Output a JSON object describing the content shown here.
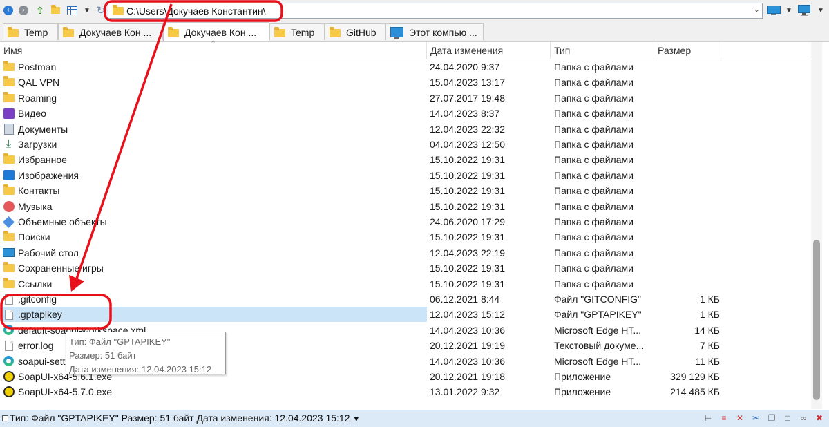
{
  "address": {
    "path": "C:\\Users\\Докучаев Константин\\"
  },
  "tabs": [
    {
      "label": "Temp",
      "icon": "folder-icon"
    },
    {
      "label": "Докучаев Кон ...",
      "icon": "folder-icon"
    },
    {
      "label": "Докучаев Кон ...",
      "icon": "folder-icon",
      "active": true
    },
    {
      "label": "Temp",
      "icon": "folder-icon"
    },
    {
      "label": "GitHub",
      "icon": "folder-icon"
    },
    {
      "label": "Этот компью ...",
      "icon": "computer-icon"
    }
  ],
  "columns": {
    "name": "Имя",
    "date": "Дата изменения",
    "type": "Тип",
    "size": "Размер"
  },
  "files": [
    {
      "name": "Postman",
      "date": "24.04.2020 9:37",
      "type": "Папка с файлами",
      "size": "",
      "icon": "folder-icon"
    },
    {
      "name": "QAL VPN",
      "date": "15.04.2023 13:17",
      "type": "Папка с файлами",
      "size": "",
      "icon": "folder-icon"
    },
    {
      "name": "Roaming",
      "date": "27.07.2017 19:48",
      "type": "Папка с файлами",
      "size": "",
      "icon": "folder-icon"
    },
    {
      "name": "Видео",
      "date": "14.04.2023 8:37",
      "type": "Папка с файлами",
      "size": "",
      "icon": "video-folder-icon"
    },
    {
      "name": "Документы",
      "date": "12.04.2023 22:32",
      "type": "Папка с файлами",
      "size": "",
      "icon": "documents-folder-icon"
    },
    {
      "name": "Загрузки",
      "date": "04.04.2023 12:50",
      "type": "Папка с файлами",
      "size": "",
      "icon": "downloads-folder-icon"
    },
    {
      "name": "Избранное",
      "date": "15.10.2022 19:31",
      "type": "Папка с файлами",
      "size": "",
      "icon": "folder-icon"
    },
    {
      "name": "Изображения",
      "date": "15.10.2022 19:31",
      "type": "Папка с файлами",
      "size": "",
      "icon": "pictures-folder-icon"
    },
    {
      "name": "Контакты",
      "date": "15.10.2022 19:31",
      "type": "Папка с файлами",
      "size": "",
      "icon": "folder-icon"
    },
    {
      "name": "Музыка",
      "date": "15.10.2022 19:31",
      "type": "Папка с файлами",
      "size": "",
      "icon": "music-folder-icon"
    },
    {
      "name": "Объемные объекты",
      "date": "24.06.2020 17:29",
      "type": "Папка с файлами",
      "size": "",
      "icon": "3d-objects-folder-icon"
    },
    {
      "name": "Поиски",
      "date": "15.10.2022 19:31",
      "type": "Папка с файлами",
      "size": "",
      "icon": "folder-icon"
    },
    {
      "name": "Рабочий стол",
      "date": "12.04.2023 22:19",
      "type": "Папка с файлами",
      "size": "",
      "icon": "desktop-folder-icon"
    },
    {
      "name": "Сохраненные игры",
      "date": "15.10.2022 19:31",
      "type": "Папка с файлами",
      "size": "",
      "icon": "folder-icon"
    },
    {
      "name": "Ссылки",
      "date": "15.10.2022 19:31",
      "type": "Папка с файлами",
      "size": "",
      "icon": "folder-icon"
    },
    {
      "name": ".gitconfig",
      "date": "06.12.2021 8:44",
      "type": "Файл \"GITCONFIG\"",
      "size": "1 КБ",
      "icon": "file-icon"
    },
    {
      "name": ".gptapikey",
      "date": "12.04.2023 15:12",
      "type": "Файл \"GPTAPIKEY\"",
      "size": "1 КБ",
      "icon": "file-icon",
      "selected": true
    },
    {
      "name": "default-soapui-workspace.xml",
      "date": "14.04.2023 10:36",
      "type": "Microsoft Edge HT...",
      "size": "14 КБ",
      "icon": "edge-icon"
    },
    {
      "name": "error.log",
      "date": "20.12.2021 19:19",
      "type": "Текстовый докуме...",
      "size": "7 КБ",
      "icon": "text-file-icon"
    },
    {
      "name": "soapui-settings.xml",
      "date": "14.04.2023 10:36",
      "type": "Microsoft Edge HT...",
      "size": "11 КБ",
      "icon": "edge-icon"
    },
    {
      "name": "SoapUI-x64-5.6.1.exe",
      "date": "20.12.2021 19:18",
      "type": "Приложение",
      "size": "329 129 КБ",
      "icon": "soapui-icon"
    },
    {
      "name": "SoapUI-x64-5.7.0.exe",
      "date": "13.01.2022 9:32",
      "type": "Приложение",
      "size": "214 485 КБ",
      "icon": "soapui-icon"
    }
  ],
  "tooltip": {
    "line1": "Тип: Файл \"GPTAPIKEY\"",
    "line2": "Размер: 51 байт",
    "line3": "Дата изменения: 12.04.2023 15:12"
  },
  "status": {
    "text": "Тип: Файл \"GPTAPIKEY\" Размер: 51 байт Дата изменения: 12.04.2023 15:12"
  },
  "colors": {
    "selection": "#cce4f7",
    "annotation": "#e8101a",
    "statusbar": "#dce9f7"
  }
}
